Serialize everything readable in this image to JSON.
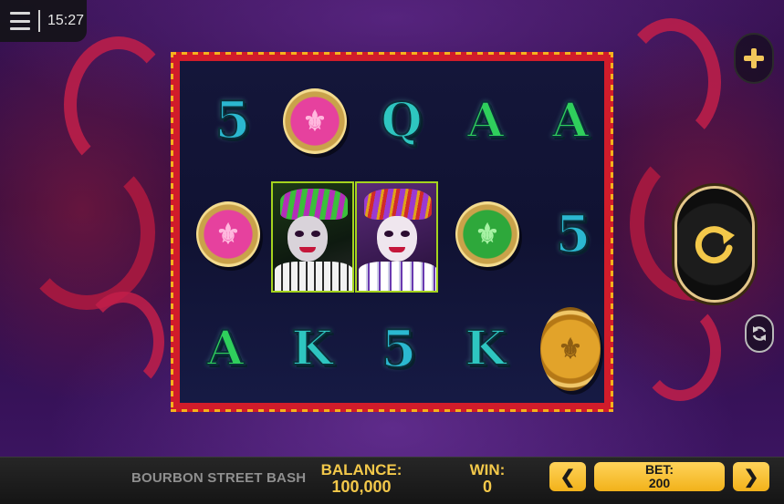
{
  "status_bar": {
    "time": "15:27"
  },
  "reels": {
    "row1": [
      {
        "symbol": "5",
        "kind": "letter"
      },
      {
        "symbol": "pink-fleur-coin",
        "kind": "coin"
      },
      {
        "symbol": "Q",
        "kind": "letter"
      },
      {
        "symbol": "A",
        "kind": "letter"
      },
      {
        "symbol": "A",
        "kind": "letter"
      }
    ],
    "row2": [
      {
        "symbol": "pink-fleur-coin",
        "kind": "coin"
      },
      {
        "symbol": "jester-green",
        "kind": "jester"
      },
      {
        "symbol": "jester-purple",
        "kind": "jester"
      },
      {
        "symbol": "green-fleur-coin",
        "kind": "coin"
      },
      {
        "symbol": "5",
        "kind": "letter"
      }
    ],
    "row3": [
      {
        "symbol": "A",
        "kind": "letter"
      },
      {
        "symbol": "K",
        "kind": "letter"
      },
      {
        "symbol": "5",
        "kind": "letter"
      },
      {
        "symbol": "K",
        "kind": "letter"
      },
      {
        "symbol": "gold-fleur-coin",
        "kind": "coin"
      }
    ]
  },
  "coin_glyph": "⚜",
  "controls": {
    "plus_icon": "plus-icon",
    "spin_icon": "spin-icon",
    "autoplay_icon": "autoplay-icon"
  },
  "bottom_bar": {
    "game_title": "BOURBON STREET BASH",
    "balance_label": "BALANCE:",
    "balance_value": "100,000",
    "win_label": "WIN:",
    "win_value": "0",
    "bet_label": "BET:",
    "bet_value": "200",
    "bet_prev": "❮",
    "bet_next": "❯"
  },
  "colors": {
    "accent_gold": "#f3c84a",
    "frame_red": "#d11c2a",
    "background_purple": "#2a0b40"
  }
}
